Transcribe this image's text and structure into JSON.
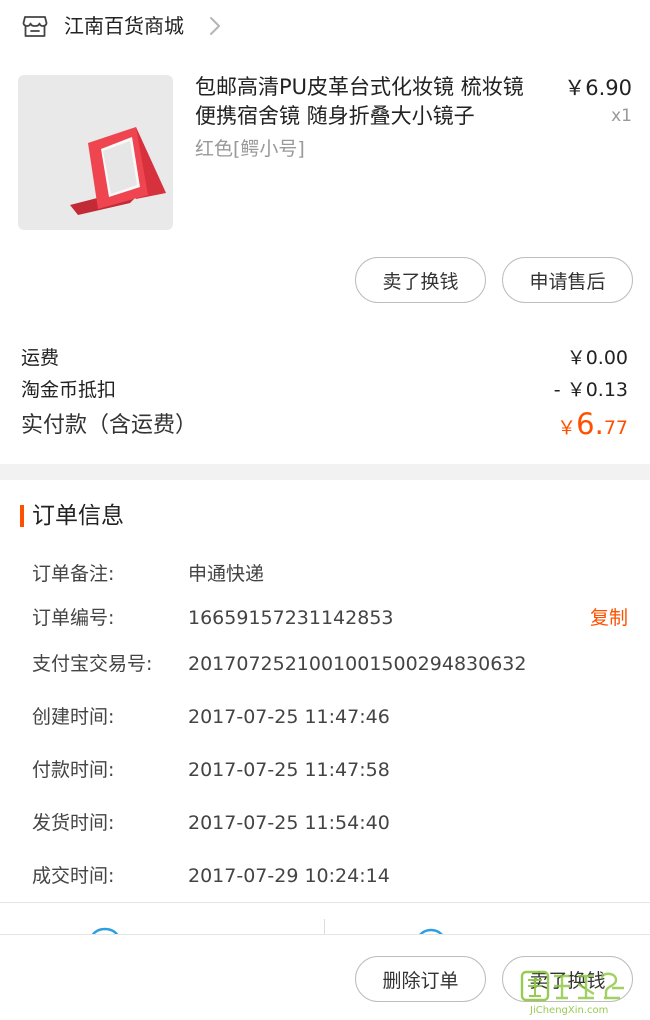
{
  "store": {
    "name": "江南百货商城"
  },
  "product": {
    "title": "包邮高清PU皮革台式化妆镜 梳妆镜便携宿舍镜 随身折叠大小镜子",
    "sku": "红色[鳄小号]",
    "price": "￥6.90",
    "qty": "x1"
  },
  "item_actions": {
    "sell_label": "卖了换钱",
    "aftersale_label": "申请售后"
  },
  "summary": {
    "shipping_label": "运费",
    "shipping_value": "￥0.00",
    "coin_label": "淘金币抵扣",
    "coin_value": "- ￥0.13",
    "paid_label": "实付款（含运费）",
    "paid_currency": "￥",
    "paid_int": "6.",
    "paid_dec": "77"
  },
  "order_info": {
    "title": "订单信息",
    "copy_label": "复制",
    "rows": [
      {
        "label": "订单备注:",
        "value": "申通快递"
      },
      {
        "label": "订单编号:",
        "value": "16659157231142853"
      },
      {
        "label": "支付宝交易号:",
        "value": "2017072521001001500294830632"
      },
      {
        "label": "创建时间:",
        "value": "2017-07-25 11:47:46"
      },
      {
        "label": "付款时间:",
        "value": "2017-07-25 11:47:58"
      },
      {
        "label": "发货时间:",
        "value": "2017-07-25 11:54:40"
      },
      {
        "label": "成交时间:",
        "value": "2017-07-29 10:24:14"
      }
    ]
  },
  "bottom_bar": {
    "delete_label": "删除订单",
    "sell_label": "卖了换钱"
  },
  "watermark": {
    "url_text": "JiChengXin.com"
  },
  "colors": {
    "accent": "#ff5000",
    "band": "#f2f2f2",
    "muted": "#999999",
    "link_blue": "#2b9fe0"
  },
  "icons": {
    "store": "store-icon",
    "chevron": "chevron-right-icon"
  }
}
